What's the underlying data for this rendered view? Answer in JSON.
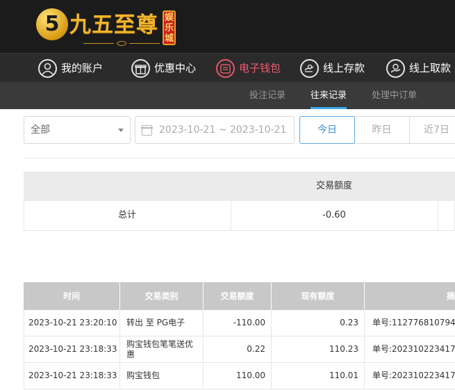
{
  "brand": {
    "logo_digit": "5",
    "name": "九五至尊",
    "badge": "娱乐城"
  },
  "main_nav": [
    {
      "label": "我的账户",
      "icon": "user-icon",
      "active": false
    },
    {
      "label": "优惠中心",
      "icon": "gift-icon",
      "active": false
    },
    {
      "label": "电子钱包",
      "icon": "wallet-icon",
      "active": true
    },
    {
      "label": "线上存款",
      "icon": "deposit-icon",
      "active": false
    },
    {
      "label": "线上取款",
      "icon": "withdraw-icon",
      "active": false
    }
  ],
  "sub_nav": [
    {
      "label": "投注记录",
      "active": false
    },
    {
      "label": "往来记录",
      "active": true
    },
    {
      "label": "处理中订单",
      "active": false
    }
  ],
  "filters": {
    "type_select": "全部",
    "date_range": "2023-10-21 ~ 2023-10-21",
    "quick_ranges": [
      {
        "label": "今日",
        "active": true
      },
      {
        "label": "昨日",
        "active": false
      },
      {
        "label": "近7日",
        "active": false
      }
    ]
  },
  "summary": {
    "header": "交易额度",
    "row_label": "总计",
    "amount": "-0.60"
  },
  "transactions": {
    "columns": [
      "时间",
      "交易类别",
      "交易额度",
      "现有额度",
      "摘"
    ],
    "rows": [
      {
        "time": "2023-10-21 23:20:10",
        "type": "转出 至 PG电子",
        "amount": "-110.00",
        "balance": "0.23",
        "note": "单号:112776810794"
      },
      {
        "time": "2023-10-21 23:18:33",
        "type": "购宝钱包笔笔送优惠",
        "amount": "0.22",
        "balance": "110.23",
        "note": "单号:202310223417"
      },
      {
        "time": "2023-10-21 23:18:33",
        "type": "购宝钱包",
        "amount": "110.00",
        "balance": "110.01",
        "note": "单号:202310223417"
      }
    ]
  },
  "colors": {
    "header_bg": "#1b1b1b",
    "nav_bg": "#2b2b2b",
    "subnav_bg": "#3a3a3a",
    "gold": "#f2b52d",
    "active_nav": "#ee5a6e",
    "accent_blue": "#3da8e8"
  }
}
